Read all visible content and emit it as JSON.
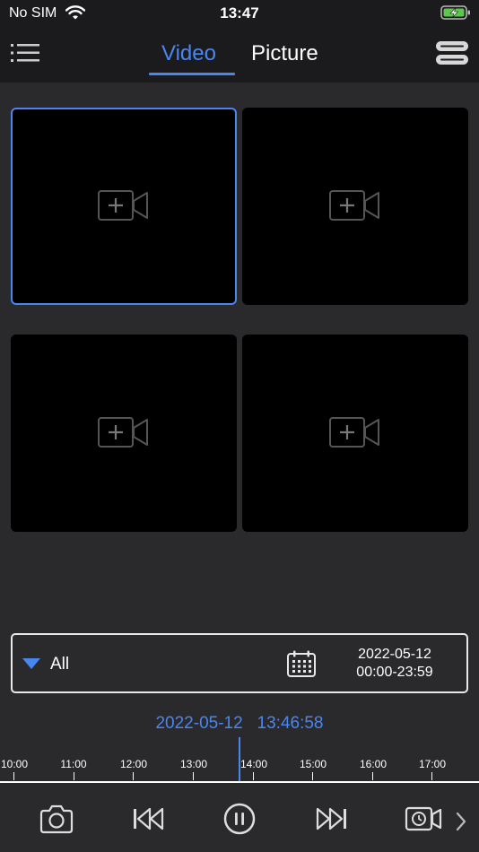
{
  "status": {
    "carrier": "No SIM",
    "time": "13:47"
  },
  "tabs": {
    "video": "Video",
    "picture": "Picture",
    "active": "Video"
  },
  "grid": {
    "cells": [
      {
        "selected": true,
        "icon": "add-video-icon"
      },
      {
        "selected": false,
        "icon": "add-video-icon"
      },
      {
        "selected": false,
        "icon": "add-video-icon"
      },
      {
        "selected": false,
        "icon": "add-video-icon"
      }
    ]
  },
  "filter": {
    "type_label": "All",
    "date": "2022-05-12",
    "time_range": "00:00-23:59"
  },
  "playback": {
    "date": "2022-05-12",
    "time": "13:46:58"
  },
  "timeline": {
    "ticks": [
      "10:00",
      "11:00",
      "12:00",
      "13:00",
      "14:00",
      "15:00",
      "16:00",
      "17:00"
    ]
  },
  "colors": {
    "accent": "#4a86f0",
    "background": "#2a2a2c",
    "bar": "#1b1b1d"
  },
  "controls": [
    "snapshot-icon",
    "rewind-icon",
    "pause-icon",
    "fast-forward-icon",
    "record-icon",
    "chevron-right-icon"
  ]
}
